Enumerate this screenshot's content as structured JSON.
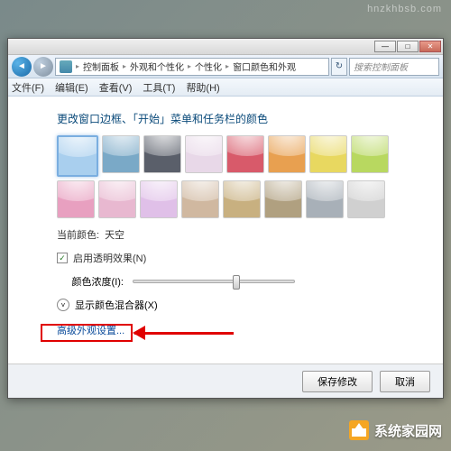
{
  "watermark": {
    "url": "hnzkhbsb.com",
    "brand": "系统家园网"
  },
  "window": {
    "controls": {
      "min": "—",
      "max": "□",
      "close": "✕"
    },
    "nav": {
      "back": "◄",
      "fwd": "►"
    },
    "breadcrumb": {
      "root": "控制面板",
      "l2": "外观和个性化",
      "l3": "个性化",
      "l4": "窗口颜色和外观",
      "sep": "▸"
    },
    "refresh": "↻",
    "search": {
      "placeholder": "搜索控制面板"
    }
  },
  "menu": {
    "file": "文件(F)",
    "edit": "编辑(E)",
    "view": "查看(V)",
    "tools": "工具(T)",
    "help": "帮助(H)"
  },
  "content": {
    "heading": "更改窗口边框、「开始」菜单和任务栏的颜色",
    "colors": [
      "#a9cfee",
      "#7aa9c7",
      "#5a5f6a",
      "#e8d8e8",
      "#d85a6a",
      "#e8a050",
      "#e8d860",
      "#b8d860",
      "#e8a0c0",
      "#e8b8d0",
      "#e0c0e8",
      "#d0b8a0",
      "#c8b080",
      "#b0a080",
      "#a8b0b8",
      "#d0d0d0"
    ],
    "selected_index": 0,
    "current_label": "当前颜色:",
    "current_value": "天空",
    "transparency": {
      "checked": "✓",
      "label": "启用透明效果(N)"
    },
    "intensity": {
      "label": "颜色浓度(I):"
    },
    "mixer": {
      "chev": "˅",
      "label": "显示颜色混合器(X)"
    },
    "advanced_link": "高级外观设置..."
  },
  "footer": {
    "save": "保存修改",
    "cancel": "取消"
  }
}
